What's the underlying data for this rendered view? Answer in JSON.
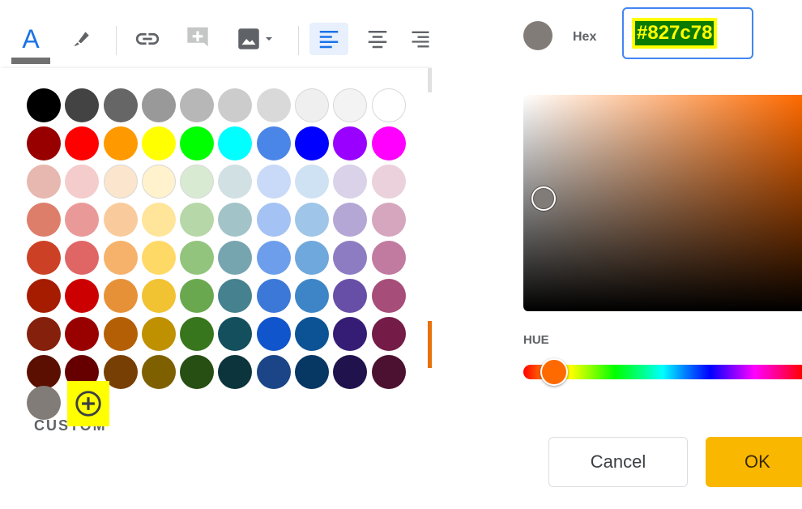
{
  "toolbar": {
    "items": [
      {
        "name": "text-color",
        "icon": "text-color-icon",
        "glyph": "A"
      },
      {
        "name": "highlight",
        "icon": "highlighter-icon"
      },
      {
        "name": "insert-link",
        "icon": "link-icon"
      },
      {
        "name": "insert-comment",
        "icon": "add-comment-icon"
      },
      {
        "name": "insert-image",
        "icon": "image-icon"
      },
      {
        "name": "align-left",
        "icon": "align-left-icon",
        "active": true
      },
      {
        "name": "align-center",
        "icon": "align-center-icon"
      },
      {
        "name": "align-right",
        "icon": "align-right-icon"
      }
    ],
    "text_color_glyph": "A",
    "accent": "#1a73e8"
  },
  "palette": {
    "rows": [
      [
        "#000000",
        "#434343",
        "#666666",
        "#999999",
        "#b7b7b7",
        "#cccccc",
        "#d9d9d9",
        "#efefef",
        "#f3f3f3",
        "#ffffff"
      ],
      [
        "#980000",
        "#ff0000",
        "#ff9900",
        "#ffff00",
        "#00ff00",
        "#00ffff",
        "#4a86e8",
        "#0000ff",
        "#9900ff",
        "#ff00ff"
      ],
      [
        "#e6b8af",
        "#f4cccc",
        "#fce5cd",
        "#fff2cc",
        "#d9ead3",
        "#d0e0e3",
        "#c9daf8",
        "#cfe2f3",
        "#d9d2e9",
        "#ead1dc"
      ],
      [
        "#dd7e6b",
        "#ea9999",
        "#f9cb9c",
        "#ffe599",
        "#b6d7a8",
        "#a2c4c9",
        "#a4c2f4",
        "#9fc5e8",
        "#b4a7d6",
        "#d5a6bd"
      ],
      [
        "#cc4125",
        "#e06666",
        "#f6b26b",
        "#ffd966",
        "#93c47d",
        "#76a5af",
        "#6d9eeb",
        "#6fa8dc",
        "#8e7cc3",
        "#c27ba0"
      ],
      [
        "#a61c00",
        "#cc0000",
        "#e69138",
        "#f1c232",
        "#6aa84f",
        "#45818e",
        "#3c78d8",
        "#3d85c6",
        "#674ea7",
        "#a64d79"
      ],
      [
        "#85200c",
        "#990000",
        "#b45f06",
        "#bf9000",
        "#38761d",
        "#134f5c",
        "#1155cc",
        "#0b5394",
        "#351c75",
        "#741b47"
      ],
      [
        "#5b0f00",
        "#660000",
        "#783f04",
        "#7f6000",
        "#274e13",
        "#0c343d",
        "#1c4587",
        "#073763",
        "#20124d",
        "#4c1130"
      ]
    ],
    "custom_label": "CUSTOM",
    "custom_colors": [
      "#827c78"
    ],
    "add_custom_icon": "add-circle-icon"
  },
  "picker": {
    "preview_color": "#827c78",
    "hex_label": "Hex",
    "hex_value": "#827c78",
    "hue_label": "HUE",
    "hue_color": "#ff6a00",
    "cancel_label": "Cancel",
    "ok_label": "OK"
  }
}
